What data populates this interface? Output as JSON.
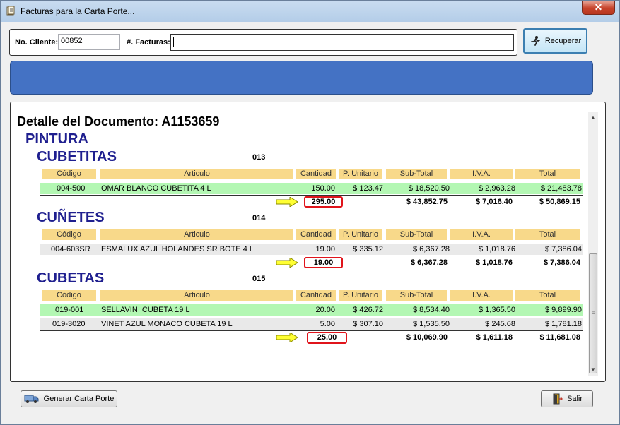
{
  "window": {
    "title": "Facturas para la Carta Porte...",
    "close": "✕"
  },
  "client": {
    "no_cliente_label": "No. Cliente:",
    "no_cliente_value": "00852",
    "facturas_label": "#. Facturas:",
    "facturas_value": "",
    "recuperar_label": "Recuperar"
  },
  "detail": {
    "title": "Detalle del Documento: A1153659",
    "category": "PINTURA",
    "columns": [
      "Código",
      "Articulo",
      "Cantidad",
      "P. Unitario",
      "Sub-Total",
      "I.V.A.",
      "Total"
    ],
    "groups": [
      {
        "name": "CUBETITAS",
        "code": "013",
        "rows": [
          {
            "codigo": "004-500",
            "articulo": "OMAR BLANCO CUBETITA 4 L",
            "cantidad": "150.00",
            "unitario": "$ 123.47",
            "subtotal": "$ 18,520.50",
            "iva": "$ 2,963.28",
            "total": "$ 21,483.78"
          }
        ],
        "totals": {
          "cantidad": "295.00",
          "subtotal": "$ 43,852.75",
          "iva": "$ 7,016.40",
          "total": "$ 50,869.15"
        }
      },
      {
        "name": "CUÑETES",
        "code": "014",
        "rows": [
          {
            "codigo": "004-603SR",
            "articulo": "ESMALUX AZUL HOLANDES SR BOTE 4 L",
            "cantidad": "19.00",
            "unitario": "$ 335.12",
            "subtotal": "$ 6,367.28",
            "iva": "$ 1,018.76",
            "total": "$ 7,386.04"
          }
        ],
        "totals": {
          "cantidad": "19.00",
          "subtotal": "$ 6,367.28",
          "iva": "$ 1,018.76",
          "total": "$ 7,386.04"
        }
      },
      {
        "name": "CUBETAS",
        "code": "015",
        "rows": [
          {
            "codigo": "019-001",
            "articulo": "SELLAVIN  CUBETA 19 L",
            "cantidad": "20.00",
            "unitario": "$ 426.72",
            "subtotal": "$ 8,534.40",
            "iva": "$ 1,365.50",
            "total": "$ 9,899.90"
          },
          {
            "codigo": "019-3020",
            "articulo": "VINET AZUL MONACO CUBETA 19 L",
            "cantidad": "5.00",
            "unitario": "$ 307.10",
            "subtotal": "$ 1,535.50",
            "iva": "$ 245.68",
            "total": "$ 1,781.18"
          }
        ],
        "totals": {
          "cantidad": "25.00",
          "subtotal": "$ 10,069.90",
          "iva": "$ 1,611.18",
          "total": "$ 11,681.08"
        }
      }
    ]
  },
  "footer": {
    "generar_label": "Generar Carta Porte",
    "salir_label": "Salir"
  },
  "colors": {
    "accent_blue": "#4472c4",
    "header_yellow": "#f8d98a",
    "row_green": "#b3f7b3",
    "highlight_red": "#e0141b",
    "group_title": "#1f1f8f"
  },
  "icons": {
    "app": "document-icon",
    "recuperar": "running-man-icon",
    "generar": "truck-icon",
    "salir": "exit-door-icon"
  }
}
